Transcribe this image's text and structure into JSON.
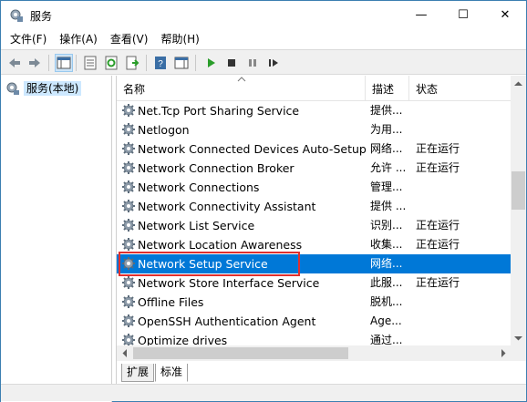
{
  "window": {
    "title": "服务",
    "minimize_glyph": "—",
    "maximize_glyph": "☐",
    "close_glyph": "✕"
  },
  "menu": [
    "文件(F)",
    "操作(A)",
    "查看(V)",
    "帮助(H)"
  ],
  "tree": {
    "root_label": "服务(本地)"
  },
  "columns": {
    "name": "名称",
    "description": "描述",
    "status": "状态"
  },
  "services": [
    {
      "name": "Net.Tcp Port Sharing Service",
      "description": "提供...",
      "status": ""
    },
    {
      "name": "Netlogon",
      "description": "为用...",
      "status": ""
    },
    {
      "name": "Network Connected Devices Auto-Setup",
      "description": "网络...",
      "status": "正在运行"
    },
    {
      "name": "Network Connection Broker",
      "description": "允许 ...",
      "status": "正在运行"
    },
    {
      "name": "Network Connections",
      "description": "管理...",
      "status": ""
    },
    {
      "name": "Network Connectivity Assistant",
      "description": "提供 ...",
      "status": ""
    },
    {
      "name": "Network List Service",
      "description": "识别...",
      "status": "正在运行"
    },
    {
      "name": "Network Location Awareness",
      "description": "收集...",
      "status": "正在运行"
    },
    {
      "name": "Network Setup Service",
      "description": "网络...",
      "status": ""
    },
    {
      "name": "Network Store Interface Service",
      "description": "此服...",
      "status": "正在运行"
    },
    {
      "name": "Offline Files",
      "description": "脱机...",
      "status": ""
    },
    {
      "name": "OpenSSH Authentication Agent",
      "description": "Age...",
      "status": ""
    },
    {
      "name": "Optimize drives",
      "description": "通过...",
      "status": ""
    }
  ],
  "selected_service": "Network Setup Service",
  "tabs": [
    "扩展",
    "标准"
  ],
  "colors": {
    "selection": "#0078d7",
    "highlight_box": "#e0302e"
  }
}
